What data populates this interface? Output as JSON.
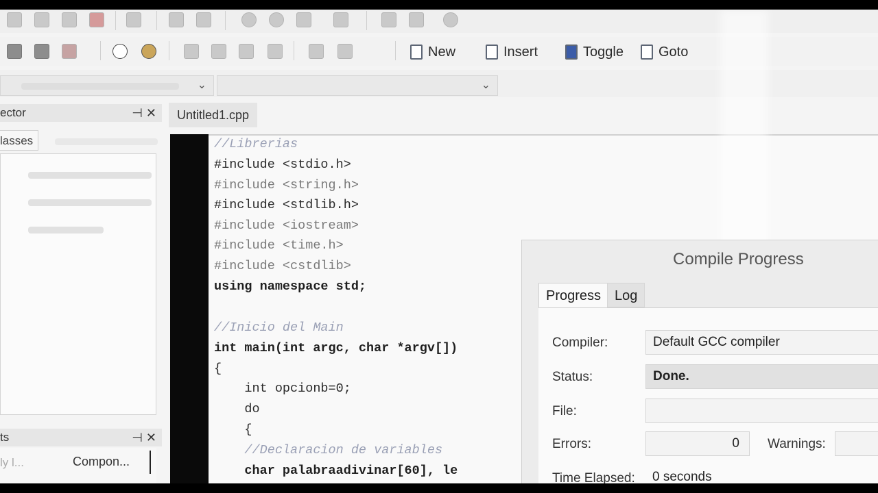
{
  "toolbar": {
    "new_label": "New",
    "insert_label": "Insert",
    "toggle_label": "Toggle",
    "goto_label": "Goto"
  },
  "left_panel": {
    "inspector_title": "ector",
    "classes_tab": "lasses",
    "bottom_title": "ts",
    "bottom_item_left": "ly l...",
    "bottom_item_right": "Compon..."
  },
  "editor": {
    "tab_label": "Untitled1.cpp",
    "lines": [
      "//Librerias",
      "#include <stdio.h>",
      "#include <string.h>",
      "#include <stdlib.h>",
      "#include <iostream>",
      "#include <time.h>",
      "#include <cstdlib>",
      "using namespace std;",
      "",
      "//Inicio del Main",
      "int main(int argc, char *argv[])",
      "{",
      "    int opcionb=0;",
      "    do",
      "    {",
      "    //Declaracion de variables",
      "    char palabraadivinar[60], le"
    ]
  },
  "dialog": {
    "title": "Compile Progress",
    "tabs": [
      "Progress",
      "Log"
    ],
    "compiler_label": "Compiler:",
    "compiler_value": "Default GCC compiler",
    "status_label": "Status:",
    "status_value": "Done.",
    "file_label": "File:",
    "file_value": "",
    "errors_label": "Errors:",
    "errors_value": "0",
    "warnings_label": "Warnings:",
    "warnings_value": "",
    "time_label": "Time Elapsed:",
    "time_value": "0 seconds"
  }
}
